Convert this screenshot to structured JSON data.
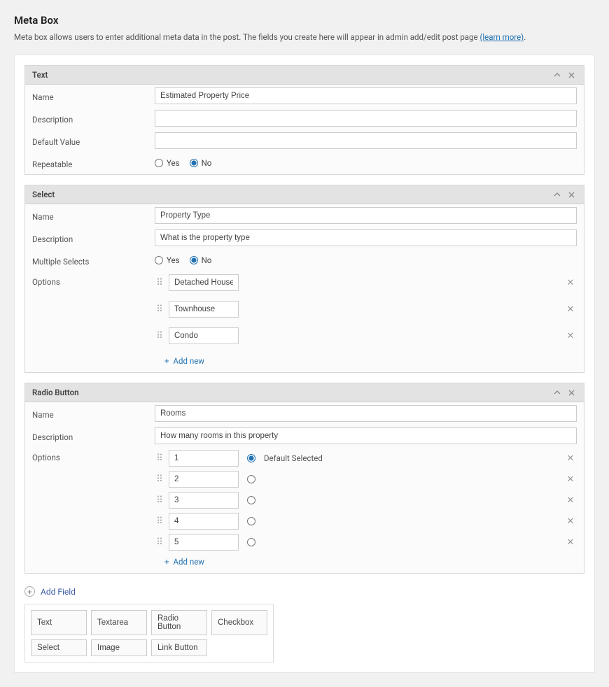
{
  "page": {
    "title": "Meta Box",
    "intro_prefix": "Meta box allows users to enter additional meta data in the post. The fields you create here will appear in admin add/edit post page ",
    "learn_more": "(learn more)",
    "intro_suffix": "."
  },
  "labels": {
    "name": "Name",
    "description": "Description",
    "default_value": "Default Value",
    "repeatable": "Repeatable",
    "multiple_selects": "Multiple Selects",
    "options": "Options",
    "yes": "Yes",
    "no": "No",
    "add_new": "Add new",
    "add_field": "Add Field",
    "default_selected": "Default Selected"
  },
  "fields": [
    {
      "type_label": "Text",
      "name": "Estimated Property Price",
      "description": "",
      "default_value": "",
      "repeatable": "no"
    },
    {
      "type_label": "Select",
      "name": "Property Type",
      "description": "What is the property type",
      "multiple": "no",
      "options": [
        "Detached House",
        "Townhouse",
        "Condo"
      ]
    },
    {
      "type_label": "Radio Button",
      "name": "Rooms",
      "description": "How many rooms in this property",
      "options": [
        "1",
        "2",
        "3",
        "4",
        "5"
      ],
      "default_index": 0
    }
  ],
  "field_types": [
    "Text",
    "Textarea",
    "Radio Button",
    "Checkbox",
    "Select",
    "Image",
    "Link Button"
  ]
}
